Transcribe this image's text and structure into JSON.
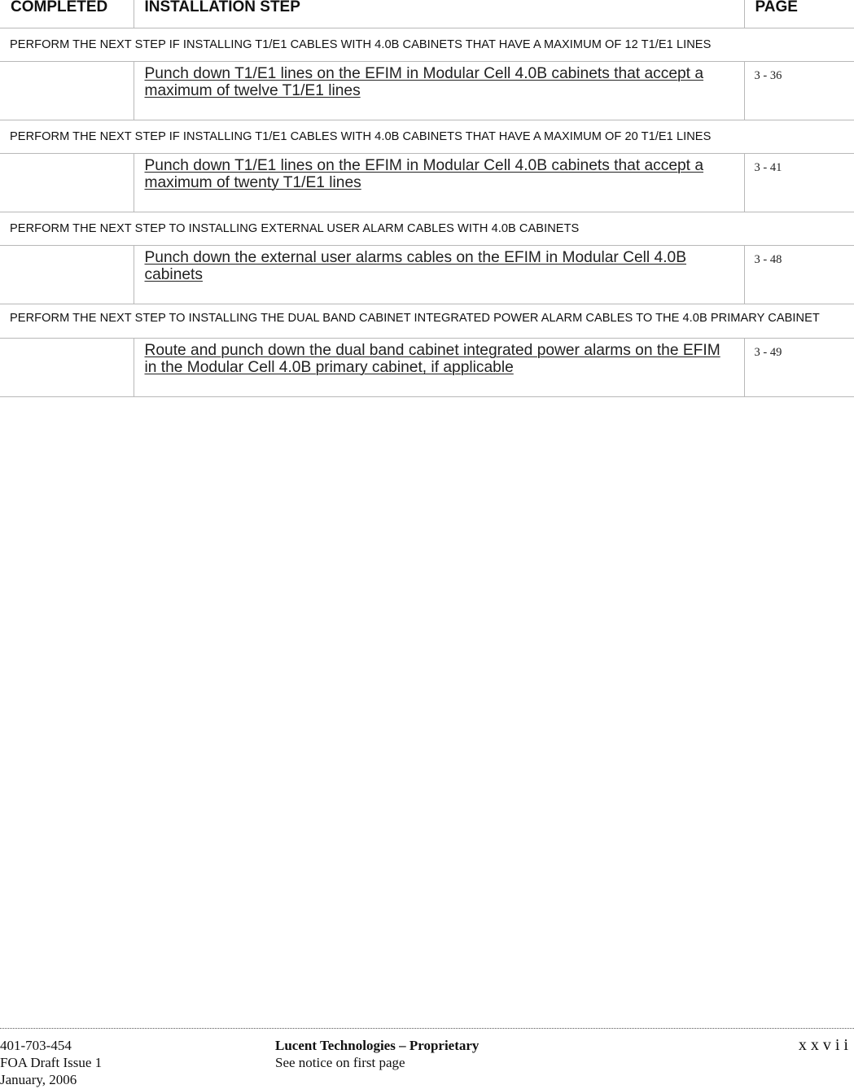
{
  "table": {
    "headers": {
      "completed": "COMPLETED",
      "step": "INSTALLATION STEP",
      "page": "PAGE"
    },
    "rows": [
      {
        "type": "condition",
        "text": "PERFORM THE NEXT STEP IF INSTALLING T1/E1 CABLES WITH 4.0B CABINETS THAT HAVE A MAXIMUM OF 12 T1/E1 LINES"
      },
      {
        "type": "step",
        "text": "Punch down T1/E1 lines on the EFIM in Modular Cell 4.0B cabinets that accept a maximum of twelve T1/E1 lines",
        "page": "3 - 36"
      },
      {
        "type": "condition",
        "text": "PERFORM THE NEXT STEP IF INSTALLING T1/E1 CABLES WITH 4.0B CABINETS THAT HAVE A MAXIMUM OF 20 T1/E1 LINES"
      },
      {
        "type": "step",
        "text": "Punch down T1/E1 lines on the EFIM in Modular Cell 4.0B cabinets that accept a maximum of twenty T1/E1 lines",
        "page": "3 - 41"
      },
      {
        "type": "condition",
        "text": "PERFORM THE NEXT STEP TO INSTALLING EXTERNAL USER ALARM CABLES WITH 4.0B CABINETS"
      },
      {
        "type": "step",
        "text": "Punch down the external user alarms cables on the EFIM in Modular Cell 4.0B cabinets",
        "page": "3 - 48"
      },
      {
        "type": "condition",
        "text": "PERFORM THE NEXT STEP TO INSTALLING THE DUAL BAND CABINET INTEGRATED POWER ALARM CABLES TO THE 4.0B PRIMARY CABINET"
      },
      {
        "type": "step",
        "text": "Route and punch down the dual band cabinet integrated power alarms on the EFIM in the Modular Cell 4.0B primary cabinet, if applicable",
        "page": "3 - 49"
      }
    ]
  },
  "footer": {
    "doc_number": "401-703-454",
    "issue": "FOA Draft Issue 1",
    "date": "January, 2006",
    "company": "Lucent Technologies – Proprietary",
    "notice": "See notice on first page",
    "page_number": "xxvii"
  },
  "colors": {
    "text": "#1a1a1a",
    "rule": "#b8b8b8",
    "background": "#ffffff"
  }
}
